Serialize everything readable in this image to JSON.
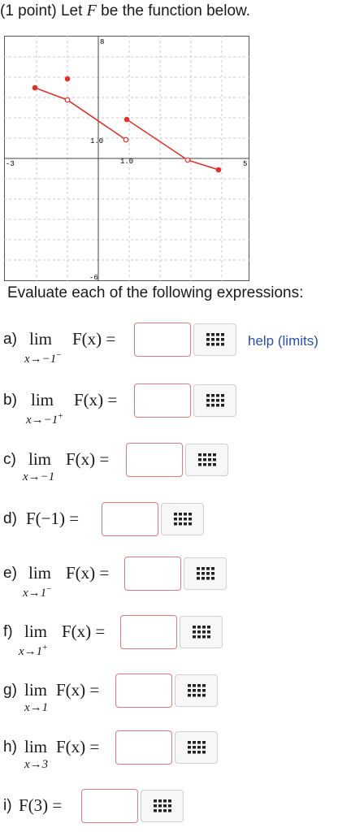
{
  "header": {
    "prefix": "(1 point) Let ",
    "var": "F",
    "suffix": " be the function below."
  },
  "graph": {
    "x_min_label": "-3",
    "x_max_label": "5",
    "y_max_label": "8",
    "y_min_label": "-6",
    "tick_label_x": "1.0",
    "tick_label_y": "1.0",
    "line_color": "#e0312a"
  },
  "intro": "Evaluate each of the following expressions:",
  "help_link": "help (limits)",
  "questions": [
    {
      "label": "a)",
      "expr": "F(x) =",
      "sub": "x→−1",
      "sup": "−"
    },
    {
      "label": "b)",
      "expr": "F(x) =",
      "sub": "x→−1",
      "sup": "+"
    },
    {
      "label": "c)",
      "expr": "F(x) =",
      "sub": "x→−1",
      "sup": ""
    },
    {
      "label": "d)",
      "expr": "F(−1) ="
    },
    {
      "label": "e)",
      "expr": "F(x) =",
      "sub": "x→1",
      "sup": "−"
    },
    {
      "label": "f)",
      "expr": "F(x) =",
      "sub": "x→1",
      "sup": "+"
    },
    {
      "label": "g)",
      "expr": "F(x) =",
      "sub": "x→1",
      "sup": ""
    },
    {
      "label": "h)",
      "expr": "F(x) =",
      "sub": "x→3",
      "sup": ""
    },
    {
      "label": "i)",
      "expr": "F(3) ="
    }
  ],
  "lim_word": "lim",
  "answer_values": [
    "",
    "",
    "",
    "",
    "",
    "",
    "",
    "",
    ""
  ]
}
